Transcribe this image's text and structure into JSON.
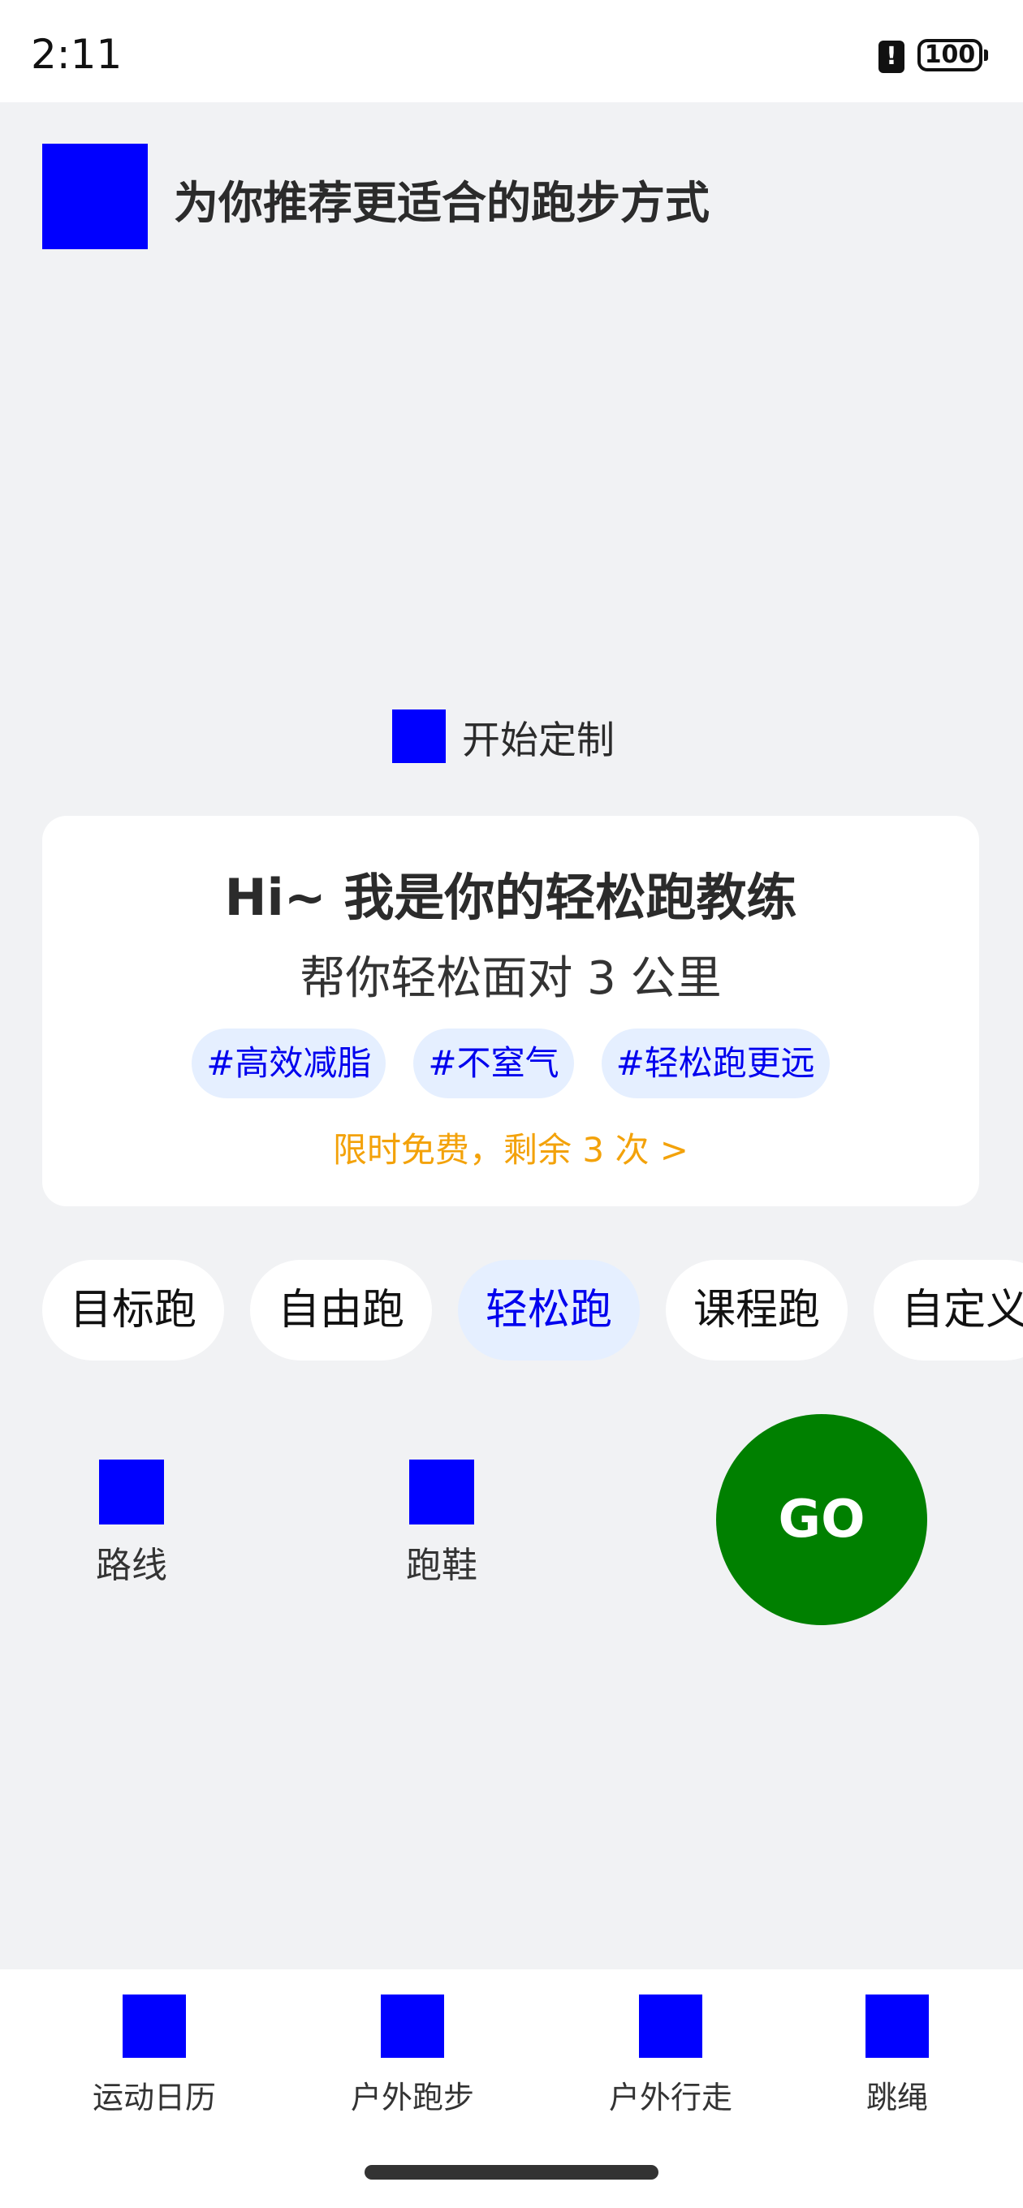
{
  "status_bar": {
    "time": "2:11",
    "battery": "100"
  },
  "header": {
    "title": "为你推荐更适合的跑步方式"
  },
  "customize": {
    "label": "开始定制"
  },
  "coach_card": {
    "title": "Hi~ 我是你的轻松跑教练",
    "subtitle": "帮你轻松面对 3 公里",
    "tags": [
      "#高效减脂",
      "#不窒气",
      "#轻松跑更远"
    ],
    "promo": "限时免费，剩余 3 次 >"
  },
  "modes": {
    "items": [
      "目标跑",
      "自由跑",
      "轻松跑",
      "课程跑",
      "自定义"
    ],
    "active": "轻松跑"
  },
  "tools": {
    "route_label": "路线",
    "shoes_label": "跑鞋"
  },
  "go_button": {
    "label": "GO"
  },
  "bottom_nav": {
    "items": [
      "运动日历",
      "户外跑步",
      "户外行走",
      "跳绳"
    ]
  },
  "colors": {
    "accent_blue": "#0000ee",
    "go_green": "#008000",
    "promo_orange": "#f3a20a",
    "placeholder_icon": "#0000ff"
  }
}
